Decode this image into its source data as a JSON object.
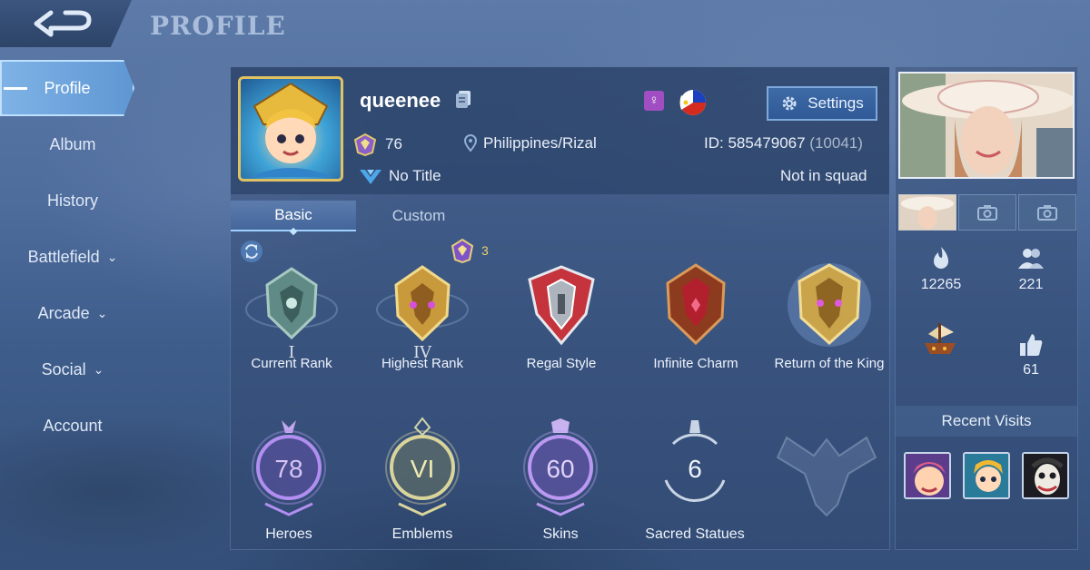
{
  "header": {
    "title": "PROFILE"
  },
  "sidebar": {
    "items": [
      {
        "label": "Profile"
      },
      {
        "label": "Album"
      },
      {
        "label": "History"
      },
      {
        "label": "Battlefield"
      },
      {
        "label": "Arcade"
      },
      {
        "label": "Social"
      },
      {
        "label": "Account"
      }
    ]
  },
  "profile": {
    "username": "queenee",
    "level": "76",
    "location": "Philippines/Rizal",
    "id_label": "ID:",
    "id_value": "585479067",
    "server": "(10041)",
    "title": "No Title",
    "squad": "Not in squad",
    "settings_label": "Settings",
    "gender_symbol": "♀"
  },
  "tabs": [
    {
      "label": "Basic"
    },
    {
      "label": "Custom"
    }
  ],
  "season_badge": "3",
  "ranks": [
    {
      "label": "Current Rank",
      "roman": "I"
    },
    {
      "label": "Highest Rank",
      "roman": "IV"
    },
    {
      "label": "Regal Style",
      "roman": ""
    },
    {
      "label": "Infinite Charm",
      "roman": ""
    },
    {
      "label": "Return of the King",
      "roman": ""
    }
  ],
  "stats": [
    {
      "label": "Heroes",
      "value": "78",
      "color": "#b99cf2"
    },
    {
      "label": "Emblems",
      "value": "VI",
      "color": "#e8e6a0"
    },
    {
      "label": "Skins",
      "value": "60",
      "color": "#c7a6f5"
    },
    {
      "label": "Sacred Statues",
      "value": "6",
      "color": "#e6eef8"
    }
  ],
  "side_stats": {
    "popularity": "12265",
    "friends": "221",
    "likes": "61"
  },
  "recent_visits": {
    "title": "Recent Visits"
  },
  "colors": {
    "accent": "#7fb3e6",
    "panel": "#30486e",
    "gold": "#e0c264"
  }
}
